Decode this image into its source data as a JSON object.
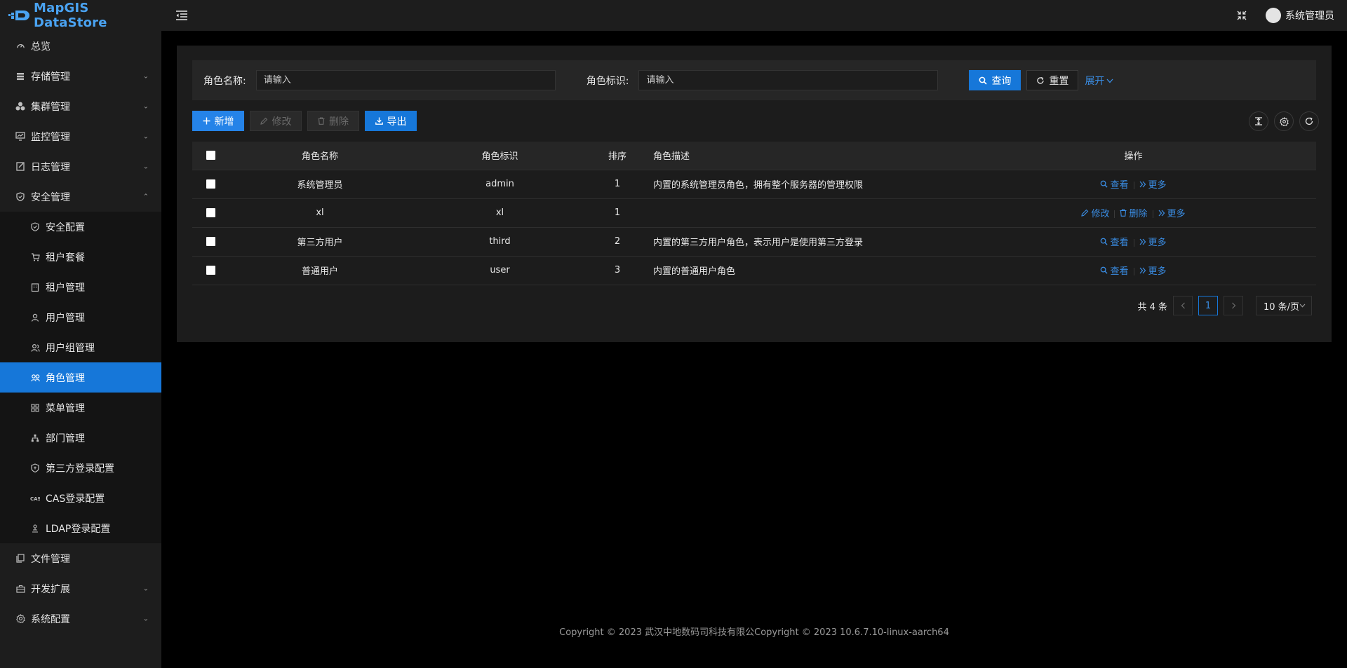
{
  "app": {
    "logo_text": "MapGIS DataStore"
  },
  "sidebar": {
    "items": [
      {
        "label": "总览",
        "icon": "dashboard-icon"
      },
      {
        "label": "存储管理",
        "icon": "storage-icon",
        "expandable": true
      },
      {
        "label": "集群管理",
        "icon": "cluster-icon",
        "expandable": true
      },
      {
        "label": "监控管理",
        "icon": "monitor-icon",
        "expandable": true
      },
      {
        "label": "日志管理",
        "icon": "log-icon",
        "expandable": true
      },
      {
        "label": "安全管理",
        "icon": "shield-icon",
        "expanded": true
      }
    ],
    "security_sub": [
      {
        "label": "安全配置",
        "icon": "shield-icon"
      },
      {
        "label": "租户套餐",
        "icon": "cart-icon"
      },
      {
        "label": "租户管理",
        "icon": "building-icon"
      },
      {
        "label": "用户管理",
        "icon": "user-icon"
      },
      {
        "label": "用户组管理",
        "icon": "user-group-icon"
      },
      {
        "label": "角色管理",
        "icon": "role-icon",
        "active": true
      },
      {
        "label": "菜单管理",
        "icon": "menu-grid-icon"
      },
      {
        "label": "部门管理",
        "icon": "org-tree-icon"
      },
      {
        "label": "第三方登录配置",
        "icon": "shield-icon"
      },
      {
        "label": "CAS登录配置",
        "icon": "cas-icon"
      },
      {
        "label": "LDAP登录配置",
        "icon": "ldap-icon"
      }
    ],
    "bottom_items": [
      {
        "label": "文件管理",
        "icon": "file-icon"
      },
      {
        "label": "开发扩展",
        "icon": "briefcase-icon",
        "expandable": true
      },
      {
        "label": "系统配置",
        "icon": "gear-icon",
        "expandable": true
      }
    ]
  },
  "header": {
    "username": "系统管理员"
  },
  "search": {
    "role_name_label": "角色名称:",
    "role_name_placeholder": "请输入",
    "role_key_label": "角色标识:",
    "role_key_placeholder": "请输入",
    "query_label": "查询",
    "reset_label": "重置",
    "expand_label": "展开"
  },
  "toolbar": {
    "add_label": "新增",
    "edit_label": "修改",
    "delete_label": "删除",
    "export_label": "导出"
  },
  "table": {
    "columns": [
      "角色名称",
      "角色标识",
      "排序",
      "角色描述",
      "操作"
    ],
    "rows": [
      {
        "name": "系统管理员",
        "key": "admin",
        "sort": "1",
        "desc": "内置的系统管理员角色，拥有整个服务器的管理权限",
        "ops": [
          "查看",
          "更多"
        ]
      },
      {
        "name": "xl",
        "key": "xl",
        "sort": "1",
        "desc": "",
        "ops": [
          "修改",
          "删除",
          "更多"
        ]
      },
      {
        "name": "第三方用户",
        "key": "third",
        "sort": "2",
        "desc": "内置的第三方用户角色，表示用户是使用第三方登录",
        "ops": [
          "查看",
          "更多"
        ]
      },
      {
        "name": "普通用户",
        "key": "user",
        "sort": "3",
        "desc": "内置的普通用户角色",
        "ops": [
          "查看",
          "更多"
        ]
      }
    ]
  },
  "pagination": {
    "total_text": "共 4 条",
    "current_page": "1",
    "page_size": "10 条/页"
  },
  "footer": {
    "text": "Copyright © 2023 武汉中地数码司科技有限公Copyright © 2023 10.6.7.10-linux-aarch64"
  },
  "colors": {
    "accent": "#1677d9",
    "link": "#3a8ee6",
    "sidebar_bg": "#1d1d1d",
    "page_bg": "#000000"
  }
}
